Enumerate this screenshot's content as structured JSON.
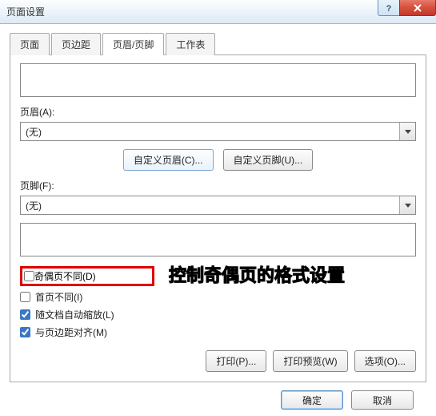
{
  "window": {
    "title": "页面设置"
  },
  "tabs": {
    "t0": "页面",
    "t1": "页边距",
    "t2": "页眉/页脚",
    "t3": "工作表"
  },
  "header": {
    "label": "页眉(A):",
    "value": "(无)"
  },
  "footer": {
    "label": "页脚(F):",
    "value": "(无)"
  },
  "buttons": {
    "custom_header": "自定义页眉(C)...",
    "custom_footer": "自定义页脚(U)...",
    "print": "打印(P)...",
    "preview": "打印预览(W)",
    "options": "选项(O)...",
    "ok": "确定",
    "cancel": "取消"
  },
  "checks": {
    "odd_even": "奇偶页不同(D)",
    "first_page": "首页不同(I)",
    "scale_doc": "随文档自动缩放(L)",
    "align_margin": "与页边距对齐(M)"
  },
  "annotation": "控制奇偶页的格式设置"
}
